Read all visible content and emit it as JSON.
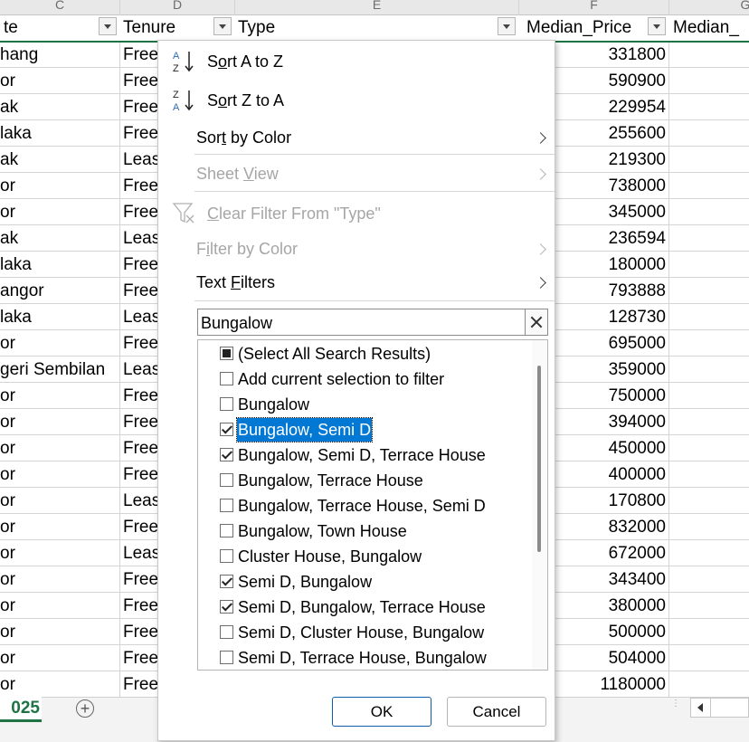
{
  "columns": {
    "c_letter": "C",
    "d_letter": "D",
    "e_letter": "E",
    "f_letter": "F",
    "g_letter": "G"
  },
  "headers": {
    "c": "te",
    "d": "Tenure",
    "e": "Type",
    "f": "Median_Price",
    "g": "Median_"
  },
  "rows": [
    {
      "state": "hang",
      "tenure": "Free",
      "price": "331800"
    },
    {
      "state": "or",
      "tenure": "Free",
      "price": "590900"
    },
    {
      "state": "ak",
      "tenure": "Free",
      "price": "229954"
    },
    {
      "state": "laka",
      "tenure": "Free",
      "price": "255600"
    },
    {
      "state": "ak",
      "tenure": "Leas",
      "price": "219300"
    },
    {
      "state": "or",
      "tenure": "Free",
      "price": "738000"
    },
    {
      "state": "or",
      "tenure": "Free",
      "price": "345000"
    },
    {
      "state": "ak",
      "tenure": "Leas",
      "price": "236594"
    },
    {
      "state": "laka",
      "tenure": "Free",
      "price": "180000"
    },
    {
      "state": "angor",
      "tenure": "Free",
      "price": "793888"
    },
    {
      "state": "laka",
      "tenure": "Leas",
      "price": "128730"
    },
    {
      "state": "or",
      "tenure": "Free",
      "price": "695000"
    },
    {
      "state": "geri Sembilan",
      "tenure": "Leas",
      "price": "359000"
    },
    {
      "state": "or",
      "tenure": "Free",
      "price": "750000"
    },
    {
      "state": "or",
      "tenure": "Free",
      "price": "394000"
    },
    {
      "state": "or",
      "tenure": "Free",
      "price": "450000"
    },
    {
      "state": "or",
      "tenure": "Free",
      "price": "400000"
    },
    {
      "state": "or",
      "tenure": "Leas",
      "price": "170800"
    },
    {
      "state": "or",
      "tenure": "Free",
      "price": "832000"
    },
    {
      "state": "or",
      "tenure": "Leas",
      "price": "672000"
    },
    {
      "state": "or",
      "tenure": "Free",
      "price": "343400"
    },
    {
      "state": "or",
      "tenure": "Free",
      "price": "380000"
    },
    {
      "state": "or",
      "tenure": "Free",
      "price": "500000"
    },
    {
      "state": "or",
      "tenure": "Free",
      "price": "504000"
    },
    {
      "state": "or",
      "tenure": "Free",
      "price": "1180000"
    }
  ],
  "sheet_tab": "025",
  "add_sheet": "+",
  "menu": {
    "sort_az": {
      "pre": "S",
      "ul": "o",
      "post": "rt A to Z",
      "icon_top": "A",
      "icon_bottom": "Z"
    },
    "sort_za": {
      "pre": "S",
      "ul": "o",
      "post": "rt Z to A",
      "icon_top": "Z",
      "icon_bottom": "A"
    },
    "sort_color": {
      "pre": "Sor",
      "ul": "t",
      "post": " by Color"
    },
    "sheet_view": {
      "pre": "Sheet ",
      "ul": "V",
      "post": "iew"
    },
    "clear_filter": {
      "pre": "",
      "ul": "C",
      "post": "lear Filter From \"Type\""
    },
    "filter_color": {
      "pre": "F",
      "ul": "i",
      "post": "lter by Color"
    },
    "text_filters": {
      "pre": "Text ",
      "ul": "F",
      "post": "ilters"
    },
    "search_value": "Bungalow",
    "items": [
      {
        "label": "(Select All Search Results)",
        "state": "ind"
      },
      {
        "label": "Add current selection to filter",
        "state": "unchecked"
      },
      {
        "label": "Bungalow",
        "state": "unchecked"
      },
      {
        "label": "Bungalow, Semi D",
        "state": "checked",
        "selected": true
      },
      {
        "label": "Bungalow, Semi D, Terrace House",
        "state": "checked"
      },
      {
        "label": "Bungalow, Terrace House",
        "state": "unchecked"
      },
      {
        "label": "Bungalow, Terrace House, Semi D",
        "state": "unchecked"
      },
      {
        "label": "Bungalow, Town House",
        "state": "unchecked"
      },
      {
        "label": "Cluster House, Bungalow",
        "state": "unchecked"
      },
      {
        "label": "Semi D, Bungalow",
        "state": "checked"
      },
      {
        "label": "Semi D, Bungalow, Terrace House",
        "state": "checked"
      },
      {
        "label": "Semi D, Cluster House, Bungalow",
        "state": "unchecked"
      },
      {
        "label": "Semi D, Terrace House, Bungalow",
        "state": "unchecked"
      }
    ],
    "ok_label": "OK",
    "cancel_label": "Cancel"
  },
  "colors": {
    "accent": "#1f7244",
    "selection": "#0078d4",
    "disabled": "#a6a6a6"
  }
}
